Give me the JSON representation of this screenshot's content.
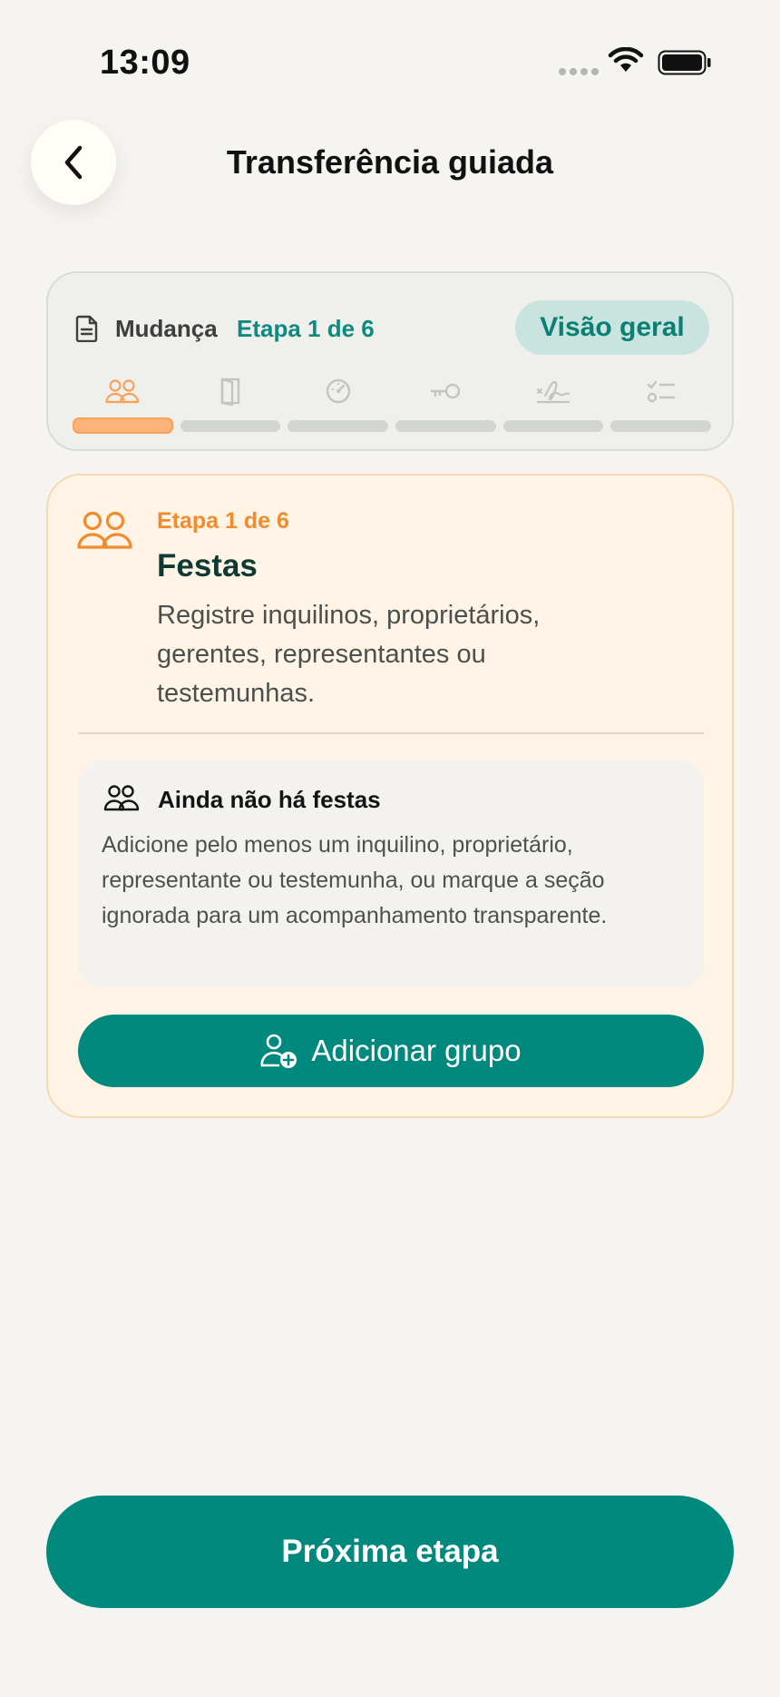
{
  "status_bar": {
    "time": "13:09"
  },
  "header": {
    "title": "Transferência guiada"
  },
  "progress": {
    "flow_name": "Mudança",
    "step_text": "Etapa 1 de 6",
    "overview_label": "Visão geral",
    "active_step": 1,
    "total_steps": 6,
    "steps": [
      {
        "icon": "people-icon"
      },
      {
        "icon": "door-icon"
      },
      {
        "icon": "meter-icon"
      },
      {
        "icon": "key-icon"
      },
      {
        "icon": "signature-icon"
      },
      {
        "icon": "checklist-icon"
      }
    ]
  },
  "step_card": {
    "step_label": "Etapa 1 de 6",
    "title": "Festas",
    "description": "Registre inquilinos, proprietários, gerentes, representantes ou testemunhas.",
    "empty_state": {
      "title": "Ainda não há festas",
      "text": "Adicione pelo menos um inquilino, proprietário, representante ou testemunha, ou marque a seção ignorada para um acompanhamento transparente."
    },
    "add_button_label": "Adicionar grupo"
  },
  "footer": {
    "next_button_label": "Próxima etapa"
  },
  "colors": {
    "accent": "#02897e",
    "accent_light": "#c9e3de",
    "step_active": "#f7a159",
    "card_bg": "#fff4e5",
    "background": "#f5f4f0"
  }
}
